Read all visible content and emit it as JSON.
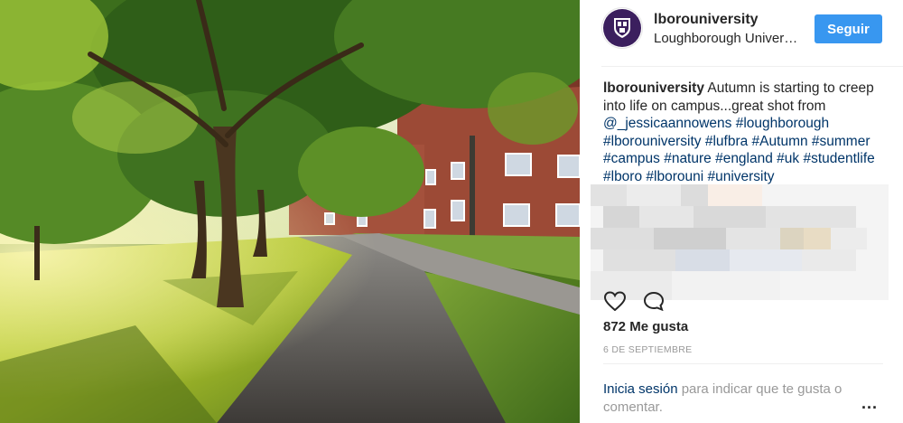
{
  "post": {
    "username": "lborouniversity",
    "location": "Loughborough University",
    "follow_label": "Seguir",
    "caption": {
      "author": "lborouniversity",
      "text": " Autumn is starting to creep into life on campus...great shot from ",
      "mention": "@_jessicaannowens",
      "hashtags": "#loughborough #lborouniversity #lufbra #Autumn #summer #campus #nature #england #uk #studentlife #lboro #lborouni #university"
    },
    "likes": "872 Me gusta",
    "date": "6 DE SEPTIEMBRE",
    "login_prompt": {
      "link": "Inicia sesión",
      "text": " para indicar que te gusta o comentar."
    },
    "more_label": "..."
  },
  "icons": [
    "heart-icon",
    "comment-icon",
    "more-options-icon",
    "university-crest-icon"
  ],
  "colors": {
    "follow_button": "#3897f0",
    "link": "#003569",
    "muted": "#999999",
    "avatar": "#3b1f5e"
  }
}
